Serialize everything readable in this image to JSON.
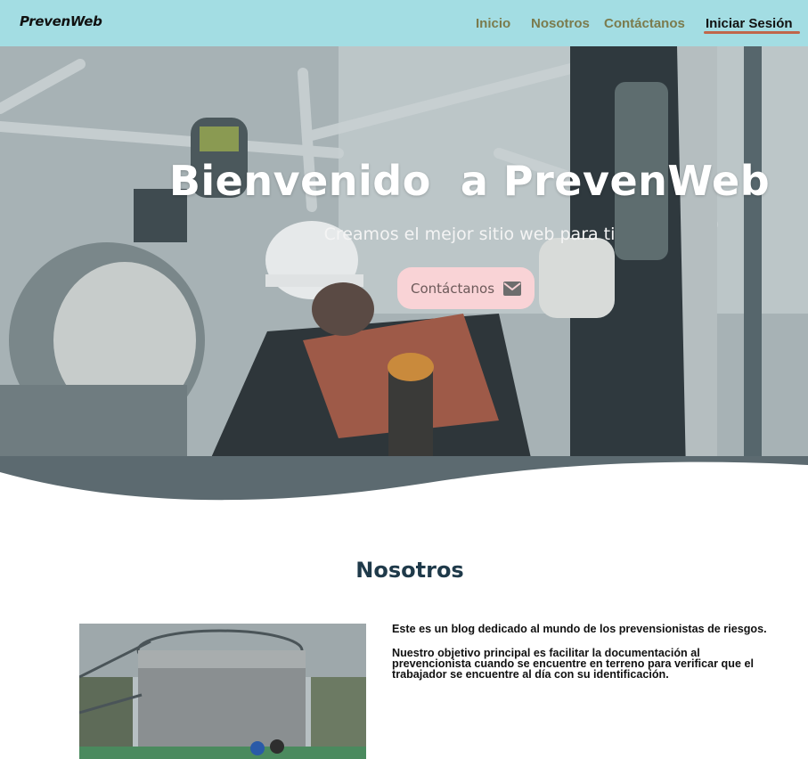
{
  "navbar": {
    "brand": "PrevenWeb",
    "links": [
      {
        "label": "Inicio",
        "active": false
      },
      {
        "label": "Nosotros",
        "active": false
      },
      {
        "label": "Contáctanos",
        "active": false
      },
      {
        "label": "Iniciar Sesión",
        "active": true
      }
    ],
    "colors": {
      "background": "#a3dde3",
      "link": "#7b7b4d",
      "active_underline": "#c0664a"
    }
  },
  "hero": {
    "title": "Bienvenido  a PrevenWeb",
    "subtitle": "Creamos el mejor sitio web para ti",
    "cta_label": "Contáctanos",
    "cta_icon": "envelope-icon",
    "cta_color": "#f9d3d6"
  },
  "about": {
    "title": "Nosotros",
    "paragraphs": [
      "Este es un blog dedicado al mundo de los prevensionistas de riesgos.",
      "Nuestro objetivo principal es facilitar la documentación al prevencionista cuando se encuentre en terreno para verificar que el trabajador se encuentre al día con su identificación."
    ]
  }
}
